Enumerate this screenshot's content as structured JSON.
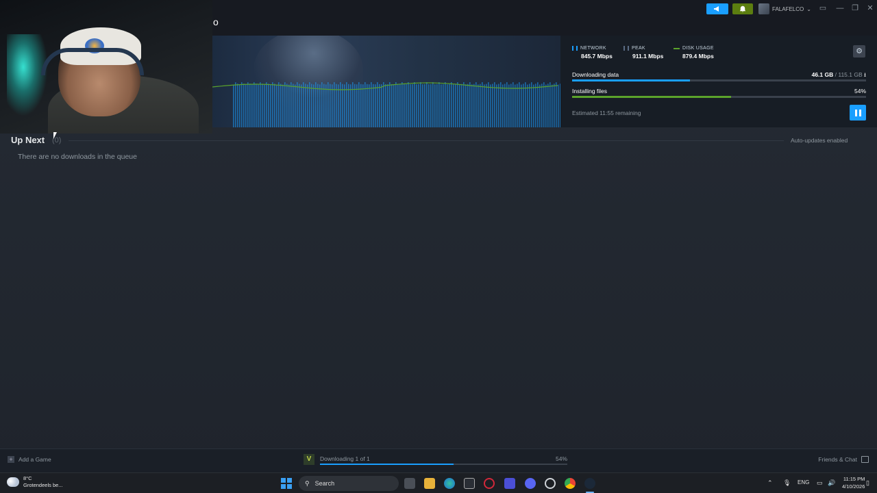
{
  "window": {
    "title_fragment": "o",
    "user_name": "FALAFELCO",
    "user_chevron": "⌄",
    "announce_icon": "megaphone-icon",
    "notify_icon": "bell-icon",
    "controls": [
      "▭",
      "—",
      "❐",
      "✕"
    ]
  },
  "stats": {
    "network": {
      "label": "NETWORK",
      "value": "845.7 Mbps",
      "color": "#1a9fff"
    },
    "peak": {
      "label": "PEAK",
      "value": "911.1 Mbps",
      "color": "#5a6c85"
    },
    "disk": {
      "label": "DISK USAGE",
      "value": "879.4 Mbps",
      "color": "#5ba32b"
    }
  },
  "download": {
    "data_label": "Downloading data",
    "data_done": "46.1 GB",
    "data_sep": " / ",
    "data_total": "115.1 GB",
    "data_progress": 0.4,
    "install_label": "Installing files",
    "install_pct": "54%",
    "install_progress": 0.54,
    "eta": "Estimated 11:55 remaining",
    "settings_icon": "gear-icon",
    "pause_icon": "pause-icon"
  },
  "up_next": {
    "title": "Up Next",
    "count": "(0)",
    "auto_updates": "Auto-updates enabled",
    "empty_message": "There are no downloads in the queue"
  },
  "bottom_bar": {
    "add_game": "Add a Game",
    "status": "Downloading 1 of 1",
    "pct": "54%",
    "progress": 0.54,
    "game_icon_letter": "V",
    "friends": "Friends & Chat"
  },
  "taskbar": {
    "temp": "8°C",
    "weather": "Grotendeels be...",
    "search": "Search",
    "lang": "ENG",
    "time": "11:15 PM",
    "date": "4/10/2026"
  },
  "colors": {
    "accent": "#1a9fff",
    "install_green": "#5ba32b",
    "notify_green": "#5c7e10"
  }
}
